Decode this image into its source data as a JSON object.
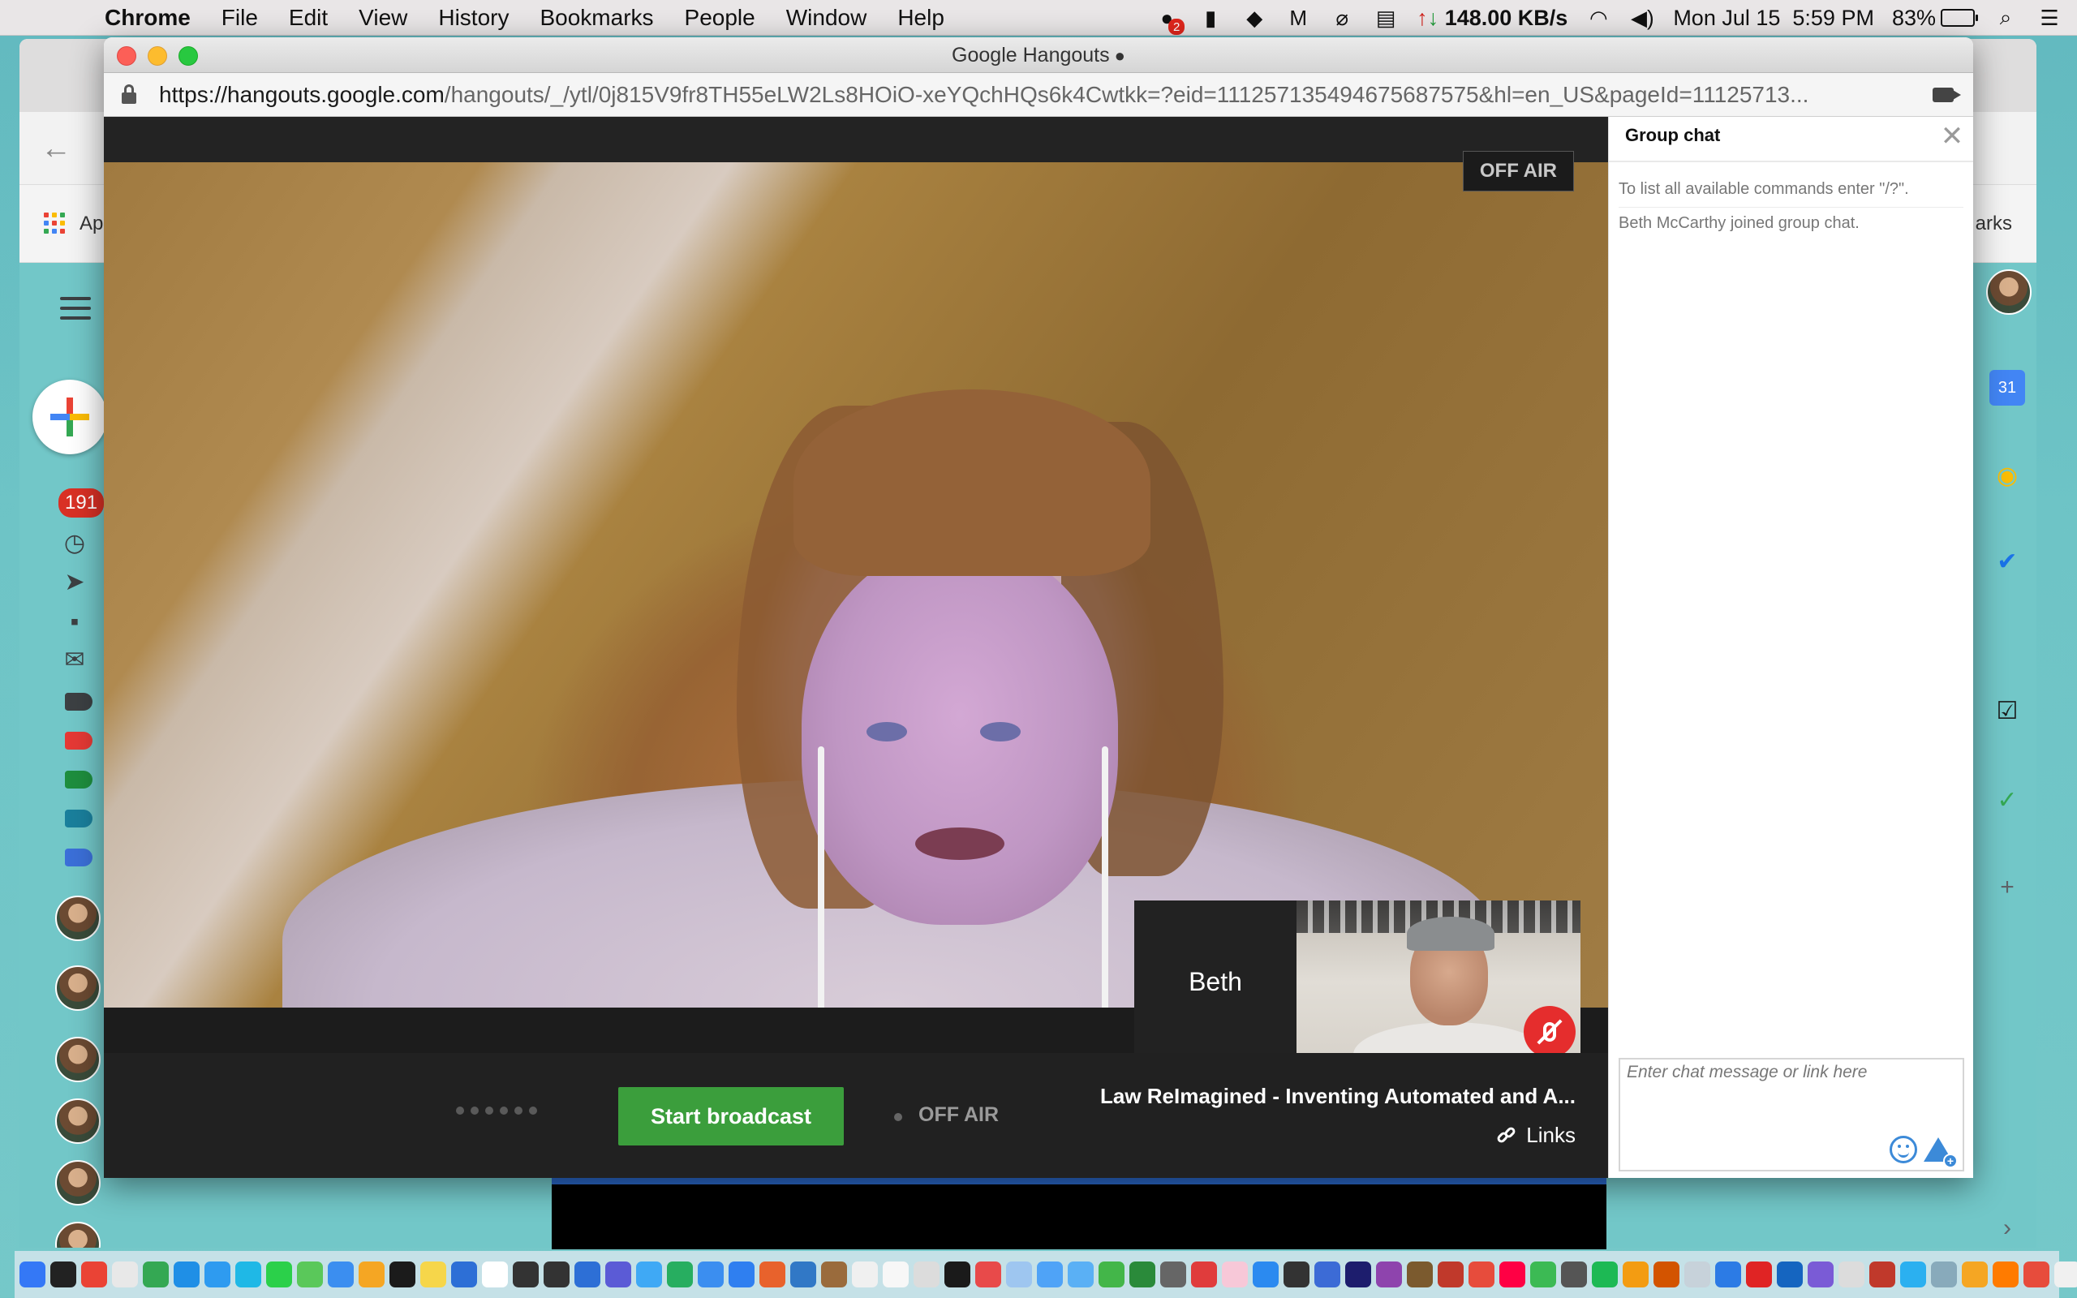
{
  "menubar": {
    "app_name": "Chrome",
    "items": [
      "File",
      "Edit",
      "View",
      "History",
      "Bookmarks",
      "People",
      "Window",
      "Help"
    ],
    "network_speed": "148.00 KB/s",
    "notification_count": "2",
    "datetime": "Mon Jul 15  5:59 PM",
    "battery_percent": "83%",
    "battery_level": 0.83
  },
  "background_window": {
    "bookmarks_left": "Ap",
    "bookmarks_right": "arks",
    "mail_count": "191",
    "calendar_day": "31"
  },
  "hangouts": {
    "window_title": "Google Hangouts",
    "url_host": "https://hangouts.google.com",
    "url_path": "/hangouts/_/ytl/0j815V9fr8TH55eLW2Ls8HOiO-xeYQchHQs6k4Cwtkk=?eid=111257135494675687575&hl=en_US&pageId=11125713...",
    "off_air_tag": "OFF AIR",
    "participant_name": "Beth",
    "controls": {
      "start_broadcast": "Start broadcast",
      "status": "OFF AIR",
      "event_title": "Law ReImagined - Inventing Automated and A...",
      "links": "Links"
    },
    "chat": {
      "title": "Group chat",
      "close": "✕",
      "messages": [
        "To list all available commands enter \"/?\".",
        "Beth McCarthy joined group chat."
      ],
      "input_placeholder": "Enter chat message or link here"
    }
  },
  "colors": {
    "broadcast_green": "#3b9e3c",
    "mute_red": "#e52d2d",
    "accent_blue": "#3c8ad8",
    "wallpaper_teal": "#72c7c8"
  }
}
